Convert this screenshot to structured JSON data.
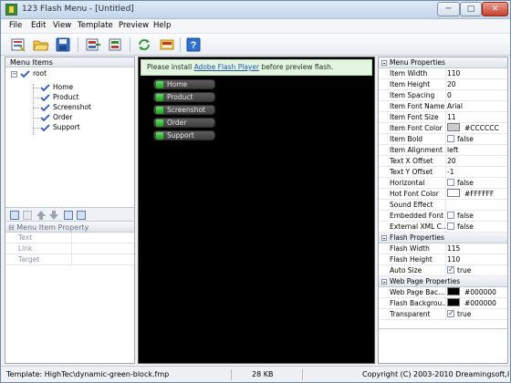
{
  "window": {
    "title": "123 Flash Menu - [Untitled]"
  },
  "title_buttons": {
    "minimize": "─",
    "maximize": "□",
    "close": "✕"
  },
  "menubar": [
    "File",
    "Edit",
    "View",
    "Template",
    "Preview",
    "Help"
  ],
  "toolbar": {
    "buttons": [
      {
        "icon": "new-menu-icon"
      },
      {
        "icon": "open-folder-icon"
      },
      {
        "icon": "save-disk-icon"
      },
      {
        "icon": "import-icon"
      },
      {
        "icon": "export-icon"
      },
      {
        "icon": "refresh-preview-icon"
      },
      {
        "icon": "publish-icon"
      },
      {
        "icon": "help-icon"
      }
    ]
  },
  "left_panel": {
    "header": "Menu Items",
    "tree": {
      "root": "root",
      "children": [
        "Home",
        "Product",
        "Screenshot",
        "Order",
        "Support"
      ]
    },
    "item_tools": [
      "add-item-icon",
      "add-subitem-icon",
      "move-up-icon",
      "move-down-icon",
      "delete-item-icon",
      "item-properties-icon"
    ],
    "property_header": "Menu Item Property",
    "properties": [
      "Text",
      "Link",
      "Target"
    ]
  },
  "preview": {
    "notice_prefix": "Please install ",
    "notice_link": "Adobe Flash Player",
    "notice_suffix": " before preview flash.",
    "items": [
      "Home",
      "Product",
      "Screenshot",
      "Order",
      "Support"
    ]
  },
  "right_panel": {
    "sections": [
      {
        "title": "Menu Properties",
        "rows": [
          {
            "name": "Item Width",
            "value": "110"
          },
          {
            "name": "Item Height",
            "value": "20"
          },
          {
            "name": "Item Spacing",
            "value": "0"
          },
          {
            "name": "Item Font Name",
            "value": "Arial"
          },
          {
            "name": "Item Font Size",
            "value": "11"
          },
          {
            "name": "Item Font Color",
            "value": "#CCCCCC",
            "swatch": "#cccccc"
          },
          {
            "name": "Item Bold",
            "value": "false",
            "checkbox": false
          },
          {
            "name": "Item Alignment",
            "value": "left"
          },
          {
            "name": "Text X Offset",
            "value": "20"
          },
          {
            "name": "Text Y Offset",
            "value": "-1"
          },
          {
            "name": "Horizontal",
            "value": "false",
            "checkbox": false
          },
          {
            "name": "Hot Font Color",
            "value": "#FFFFFF",
            "swatch": "#ffffff"
          },
          {
            "name": "Sound Effect",
            "value": ""
          },
          {
            "name": "Embedded Font",
            "value": "false",
            "checkbox": false
          },
          {
            "name": "External XML C...",
            "value": "false",
            "checkbox": false
          }
        ]
      },
      {
        "title": "Flash Properties",
        "rows": [
          {
            "name": "Flash Width",
            "value": "115"
          },
          {
            "name": "Flash Height",
            "value": "110"
          },
          {
            "name": "Auto Size",
            "value": "true",
            "checkbox": true
          }
        ]
      },
      {
        "title": "Web Page Properties",
        "rows": [
          {
            "name": "Web Page Bac...",
            "value": "#000000",
            "swatch": "#000000"
          },
          {
            "name": "Flash Backgrou...",
            "value": "#000000",
            "swatch": "#000000"
          },
          {
            "name": "Transparent",
            "value": "true",
            "checkbox": true
          }
        ]
      }
    ]
  },
  "statusbar": {
    "template": "Template:  HighTec\\dynamic-green-block.fmp",
    "size": "28 KB",
    "copyright": "Copyright (C) 2003-2010 Dreamingsoft,I"
  },
  "colors": {
    "preview_bg": "#000000",
    "menu_item_bg": "#4a4a4a",
    "menu_bullet": "#33cc33",
    "notice_bg": "#e4f5e0"
  }
}
